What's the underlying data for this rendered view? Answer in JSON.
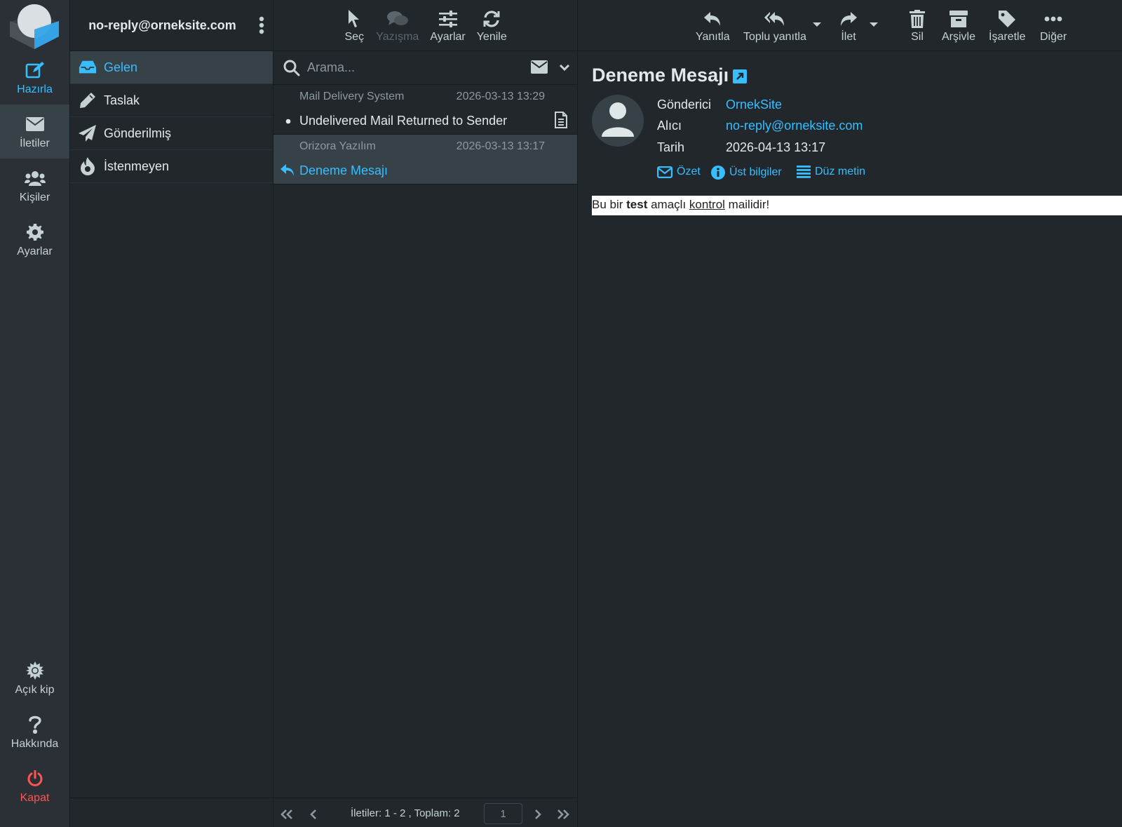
{
  "nav": {
    "compose": "Hazırla",
    "mail": "İletiler",
    "contacts": "Kişiler",
    "settings": "Ayarlar",
    "theme": "Açık kip",
    "about": "Hakkında",
    "logout": "Kapat"
  },
  "account": {
    "email": "no-reply@orneksite.com"
  },
  "folders": [
    {
      "name": "Gelen",
      "icon": "inbox-icon",
      "selected": true
    },
    {
      "name": "Taslak",
      "icon": "pencil-icon"
    },
    {
      "name": "Gönderilmiş",
      "icon": "paper-plane-icon"
    },
    {
      "name": "İstenmeyen",
      "icon": "fire-icon"
    }
  ],
  "list_toolbar": {
    "select": "Seç",
    "threads": "Yazışma",
    "options": "Ayarlar",
    "refresh": "Yenile"
  },
  "search": {
    "placeholder": "Arama..."
  },
  "messages": [
    {
      "from": "Mail Delivery System",
      "date": "2026-03-13 13:29",
      "subject": "Undelivered Mail Returned to Sender",
      "unread": true,
      "attachment": true
    },
    {
      "from": "Orizora Yazılım",
      "date": "2026-03-13 13:17",
      "subject": "Deneme Mesajı",
      "replied": true,
      "selected": true
    }
  ],
  "list_footer": {
    "count": "İletiler: 1 - 2 , Toplam: 2",
    "page": "1"
  },
  "content_toolbar": {
    "reply": "Yanıtla",
    "reply_all": "Toplu yanıtla",
    "forward": "İlet",
    "delete": "Sil",
    "archive": "Arşivle",
    "mark": "İşaretle",
    "more": "Diğer"
  },
  "message": {
    "subject": "Deneme Mesajı",
    "from_label": "Gönderici",
    "from_value": "OrnekSite",
    "to_label": "Alıcı",
    "to_value": "no-reply@orneksite.com",
    "date_label": "Tarih",
    "date_value": "2026-04-13 13:17",
    "summary_link": "Özet",
    "headers_link": "Üst bilgiler",
    "plain_link": "Düz metin",
    "body": {
      "part1": "Bu bir ",
      "bold": "test",
      "part2": " amaçlı ",
      "underline": "kontrol",
      "part3": " mailidir!"
    }
  },
  "colors": {
    "accent": "#37beff",
    "danger": "#ff5552",
    "background": "#21272b",
    "nav": "#2a3035",
    "selected": "#374148"
  }
}
